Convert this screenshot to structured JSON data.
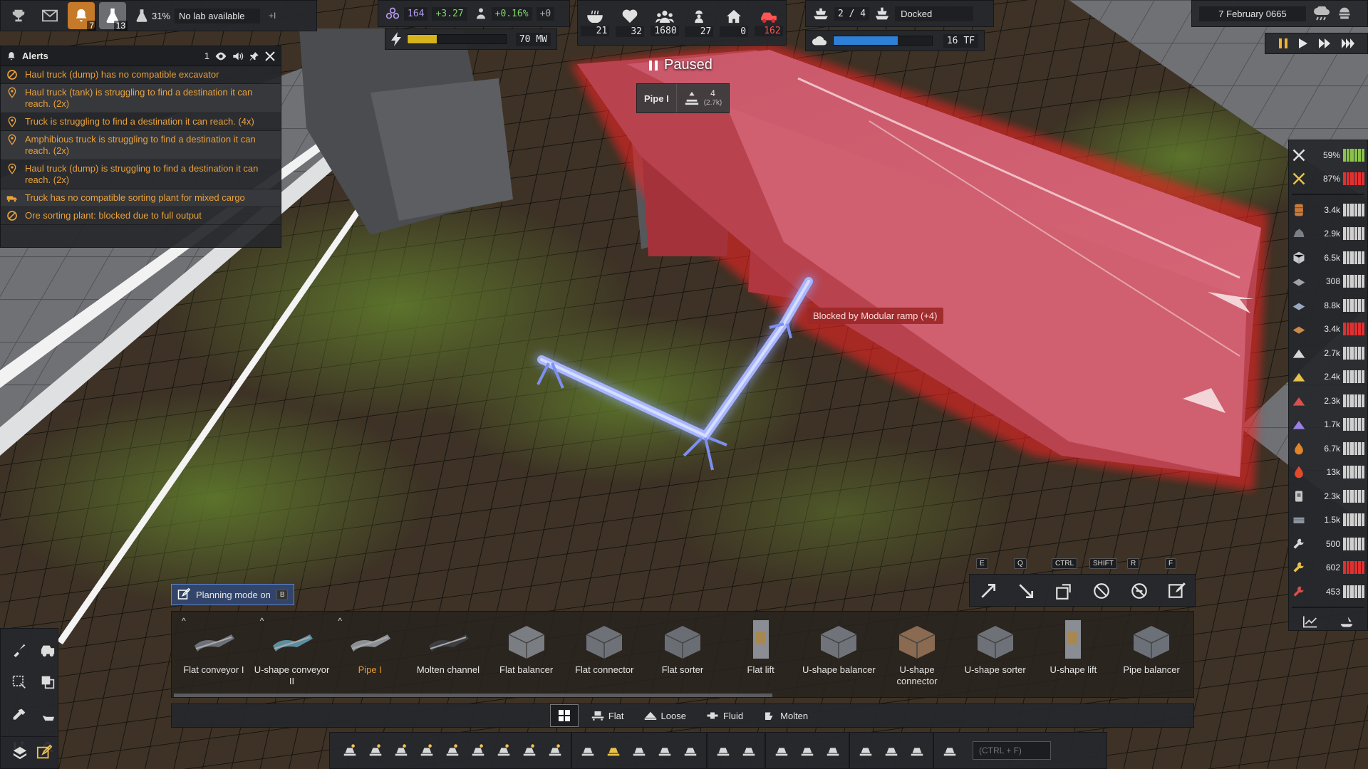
{
  "top_left": {
    "alerts_count": "7",
    "research_count": "13",
    "research_pct": "31%",
    "research_status": "No lab available",
    "research_plus": "+I"
  },
  "stats": {
    "unity": "164",
    "unity_delta": "+3.27",
    "pop_growth": "+0.16%",
    "pop_extra": "+0",
    "power": "70 MW",
    "power_level": 0.3
  },
  "pop": {
    "food": "21",
    "health": "32",
    "population": "1680",
    "workers": "27",
    "homes": "0",
    "vehicles": "162"
  },
  "ships": {
    "count": "2 / 4",
    "status": "Docked",
    "compute": "16 TF",
    "compute_level": 0.65
  },
  "date": "7 February 0665",
  "paused": "Paused",
  "pipe_tip": {
    "name": "Pipe I",
    "count": "4",
    "count_sub": "(2.7k)"
  },
  "blocked": "Blocked by Modular ramp (+4)",
  "alerts": {
    "title": "Alerts",
    "count": "1",
    "items": [
      {
        "icon": "no-entry",
        "text": "Haul truck (dump) has no compatible excavator"
      },
      {
        "icon": "map-pin",
        "text": "Haul truck (tank) is struggling to find a destination it can reach. (2x)"
      },
      {
        "icon": "map-pin",
        "text": "Truck is struggling to find a destination it can reach. (4x)"
      },
      {
        "icon": "map-pin",
        "text": "Amphibious truck is struggling to find a destination it can reach. (2x)"
      },
      {
        "icon": "map-pin",
        "text": "Haul truck (dump) is struggling to find a destination it can reach. (2x)"
      },
      {
        "icon": "truck",
        "text": "Truck has no compatible sorting plant for mixed cargo"
      },
      {
        "icon": "no-entry",
        "text": "Ore sorting plant: blocked due to full output"
      }
    ]
  },
  "resources_top": [
    {
      "icon": "tools",
      "value": "59%",
      "color": "#8bc34a"
    },
    {
      "icon": "tools-gold",
      "value": "87%",
      "color": "#e03030"
    }
  ],
  "resources": [
    {
      "icon": "barrel",
      "value": "3.4k",
      "color": "#cfcfcf"
    },
    {
      "icon": "rock",
      "value": "2.9k",
      "color": "#cfcfcf"
    },
    {
      "icon": "box",
      "value": "6.5k",
      "color": "#cfcfcf"
    },
    {
      "icon": "plate",
      "value": "308",
      "color": "#cfcfcf"
    },
    {
      "icon": "plate-blue",
      "value": "8.8k",
      "color": "#cfcfcf"
    },
    {
      "icon": "wood",
      "value": "3.4k",
      "color": "#e03030"
    },
    {
      "icon": "pile",
      "value": "2.7k",
      "color": "#cfcfcf"
    },
    {
      "icon": "pile-gold",
      "value": "2.4k",
      "color": "#cfcfcf"
    },
    {
      "icon": "pile-red",
      "value": "2.3k",
      "color": "#cfcfcf"
    },
    {
      "icon": "pile-purple",
      "value": "1.7k",
      "color": "#cfcfcf"
    },
    {
      "icon": "fuel",
      "value": "6.7k",
      "color": "#cfcfcf"
    },
    {
      "icon": "flame",
      "value": "13k",
      "color": "#cfcfcf"
    },
    {
      "icon": "canister",
      "value": "2.3k",
      "color": "#cfcfcf"
    },
    {
      "icon": "water",
      "value": "1.5k",
      "color": "#cfcfcf"
    },
    {
      "icon": "wrench",
      "value": "500",
      "color": "#cfcfcf"
    },
    {
      "icon": "wrench-gold",
      "value": "602",
      "color": "#e03030"
    },
    {
      "icon": "wrench-red",
      "value": "453",
      "color": "#cfcfcf"
    }
  ],
  "tools": [
    {
      "key": "E",
      "icon": "upgrade"
    },
    {
      "key": "Q",
      "icon": "downgrade"
    },
    {
      "key": "CTRL",
      "icon": "copy"
    },
    {
      "key": "SHIFT",
      "icon": "cancel"
    },
    {
      "key": "R",
      "icon": "recover"
    },
    {
      "key": "F",
      "icon": "plan"
    }
  ],
  "planning": {
    "label": "Planning mode on",
    "key": "B"
  },
  "palette": [
    {
      "label": "Flat conveyor I",
      "caret": true
    },
    {
      "label": "U-shape conveyor II",
      "caret": true
    },
    {
      "label": "Pipe I",
      "caret": true,
      "selected": true
    },
    {
      "label": "Molten channel"
    },
    {
      "label": "Flat balancer"
    },
    {
      "label": "Flat connector"
    },
    {
      "label": "Flat sorter"
    },
    {
      "label": "Flat lift"
    },
    {
      "label": "U-shape balancer"
    },
    {
      "label": "U-shape connector"
    },
    {
      "label": "U-shape sorter"
    },
    {
      "label": "U-shape lift"
    },
    {
      "label": "Pipe balancer"
    }
  ],
  "categories": [
    "Flat",
    "Loose",
    "Fluid",
    "Molten"
  ],
  "search_placeholder": "(CTRL + F)"
}
